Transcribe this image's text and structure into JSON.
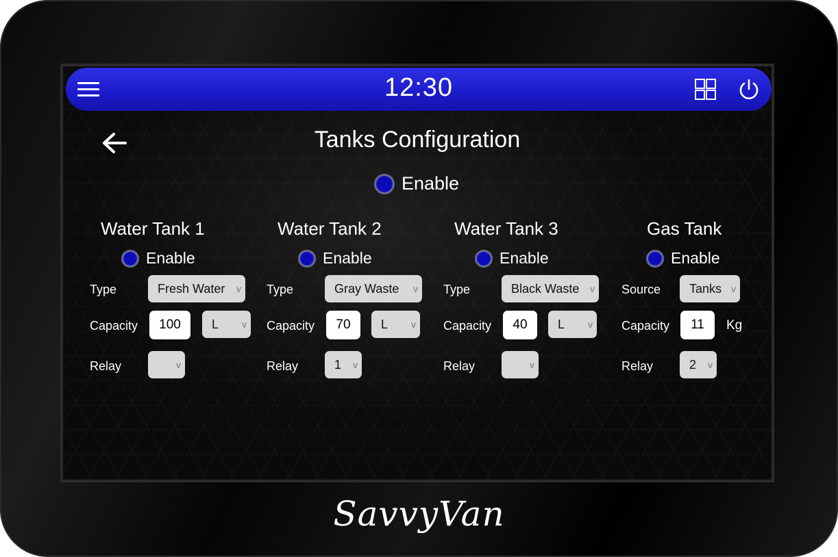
{
  "header": {
    "time": "12:30"
  },
  "page": {
    "title": "Tanks Configuration",
    "enable_label": "Enable"
  },
  "tanks": [
    {
      "title": "Water Tank 1",
      "enable_label": "Enable",
      "field1_label": "Type",
      "field1_value": "Fresh Water",
      "capacity_label": "Capacity",
      "capacity_value": "100",
      "unit_value": "L",
      "relay_label": "Relay",
      "relay_value": ""
    },
    {
      "title": "Water Tank 2",
      "enable_label": "Enable",
      "field1_label": "Type",
      "field1_value": "Gray Waste",
      "capacity_label": "Capacity",
      "capacity_value": "70",
      "unit_value": "L",
      "relay_label": "Relay",
      "relay_value": "1"
    },
    {
      "title": "Water Tank 3",
      "enable_label": "Enable",
      "field1_label": "Type",
      "field1_value": "Black Waste",
      "capacity_label": "Capacity",
      "capacity_value": "40",
      "unit_value": "L",
      "relay_label": "Relay",
      "relay_value": ""
    },
    {
      "title": "Gas Tank",
      "enable_label": "Enable",
      "field1_label": "Source",
      "field1_value": "Tanks",
      "capacity_label": "Capacity",
      "capacity_value": "11",
      "unit_value": "Kg",
      "relay_label": "Relay",
      "relay_value": "2"
    }
  ],
  "chevron": "v",
  "brand": {
    "logo_text": "SavvyVan"
  },
  "colors": {
    "topbar": "#1b1bc9",
    "radio": "#0b0bb8",
    "select_bg": "#d8d8d8"
  },
  "icons": {
    "menu": "menu-icon",
    "grid": "grid-icon",
    "power": "power-icon",
    "back": "back-arrow-icon"
  }
}
